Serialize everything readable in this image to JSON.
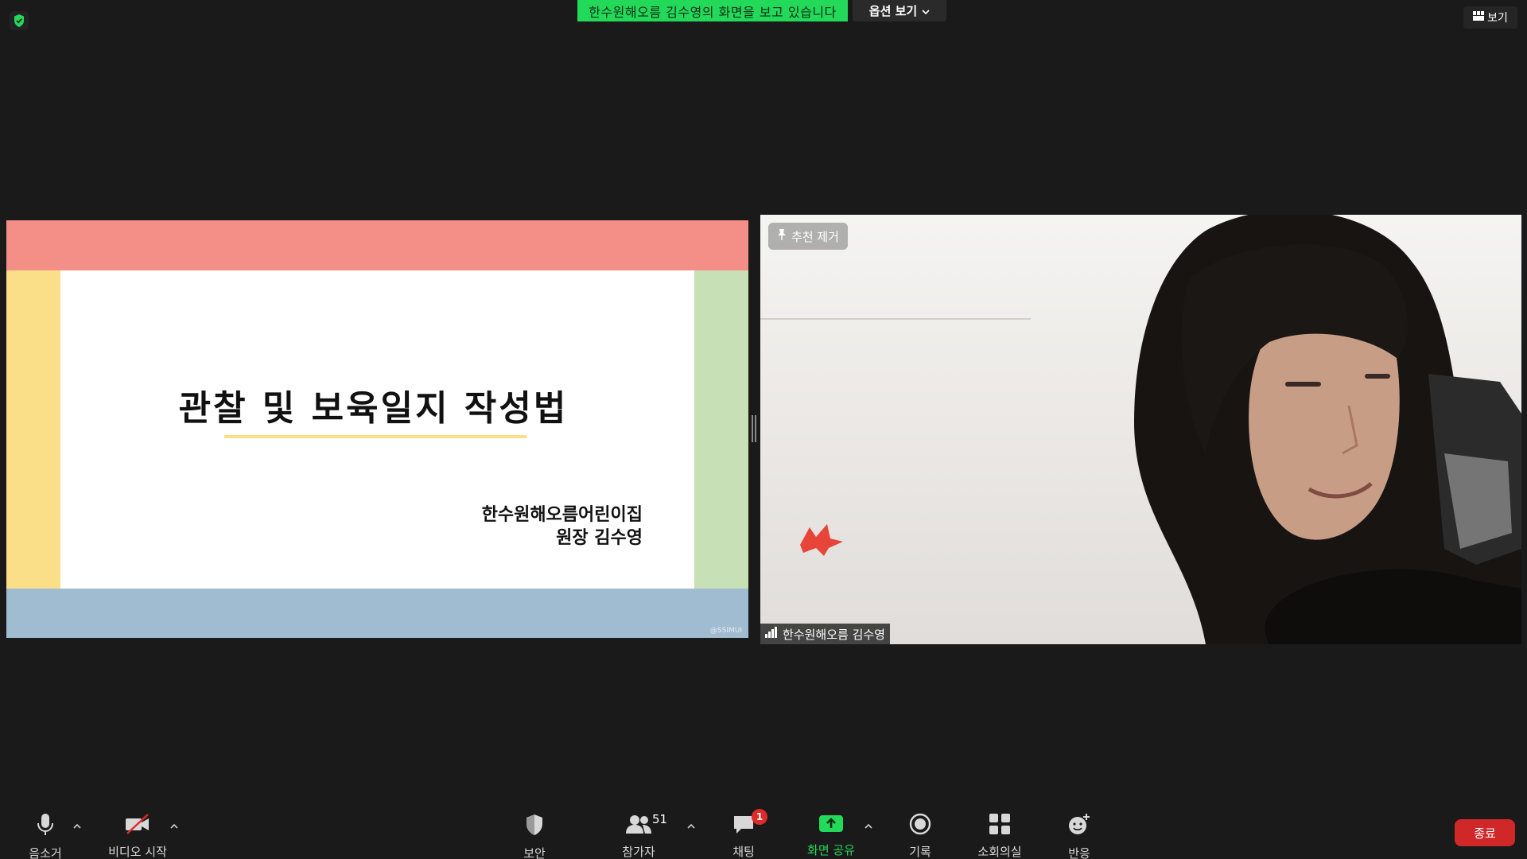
{
  "top": {
    "share_banner": "한수원해오름 김수영의 화면을 보고 있습니다",
    "options_label": "옵션 보기",
    "view_label": "보기"
  },
  "slide": {
    "title": "관찰 및 보육일지 작성법",
    "org_line1": "한수원해오름어린이집",
    "org_line2": "원장 김수영",
    "watermark": "@SSIMUI",
    "colors": {
      "top": "#f48f87",
      "left": "#fadf88",
      "right": "#c8e0b6",
      "bottom": "#9fbcd0",
      "underline": "#fadf88"
    }
  },
  "video": {
    "pin_label": "추천 제거",
    "participant_name": "한수원해오름 김수영"
  },
  "toolbar": {
    "mute_label": "음소거",
    "video_label": "비디오 시작",
    "security_label": "보안",
    "participants_label": "참가자",
    "participants_count": "51",
    "chat_label": "채팅",
    "chat_badge": "1",
    "share_label": "화면 공유",
    "record_label": "기록",
    "breakout_label": "소회의실",
    "reactions_label": "반응",
    "end_label": "종료",
    "accent": "#23d959",
    "end_color": "#d02828"
  }
}
